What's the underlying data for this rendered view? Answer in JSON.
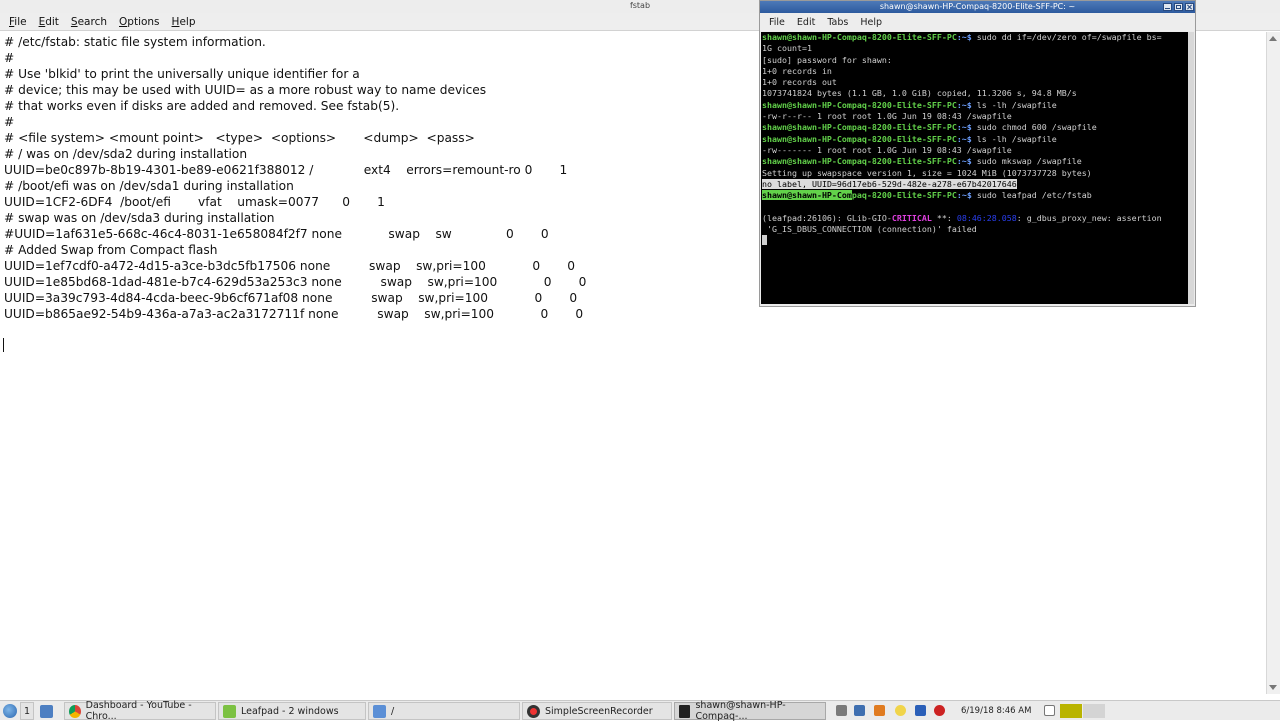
{
  "leafpad": {
    "title": "fstab",
    "menu": [
      {
        "first": "F",
        "rest": "ile"
      },
      {
        "first": "E",
        "rest": "dit"
      },
      {
        "first": "S",
        "rest": "earch"
      },
      {
        "first": "O",
        "rest": "ptions"
      },
      {
        "first": "H",
        "rest": "elp"
      }
    ],
    "lines": [
      "# /etc/fstab: static file system information.",
      "#",
      "# Use 'blkid' to print the universally unique identifier for a",
      "# device; this may be used with UUID= as a more robust way to name devices",
      "# that works even if disks are added and removed. See fstab(5).",
      "#",
      "# <file system> <mount point>   <type>  <options>       <dump>  <pass>",
      "# / was on /dev/sda2 during installation",
      "UUID=be0c897b-8b19-4301-be89-e0621f388012 /             ext4    errors=remount-ro 0       1",
      "# /boot/efi was on /dev/sda1 during installation",
      "UUID=1CF2-6DF4  /boot/efi       vfat    umask=0077      0       1",
      "# swap was on /dev/sda3 during installation",
      "#UUID=1af631e5-668c-46c4-8031-1e658084f2f7 none            swap    sw              0       0",
      "# Added Swap from Compact flash",
      "UUID=1ef7cdf0-a472-4d15-a3ce-b3dc5fb17506 none          swap    sw,pri=100            0       0",
      "UUID=1e85bd68-1dad-481e-b7c4-629d53a253c3 none          swap    sw,pri=100            0       0",
      "UUID=3a39c793-4d84-4cda-beec-9b6cf671af08 none          swap    sw,pri=100            0       0",
      "UUID=b865ae92-54b9-436a-a7a3-ac2a3172711f none          swap    sw,pri=100            0       0"
    ]
  },
  "terminal": {
    "title": "shawn@shawn-HP-Compaq-8200-Elite-SFF-PC: ~",
    "menu": [
      "File",
      "Edit",
      "Tabs",
      "Help"
    ],
    "prompt": "shawn@shawn-HP-Compaq-8200-Elite-SFF-PC",
    "path": ":~$",
    "cmd_dd_1": " sudo dd if=/dev/zero of=/swapfile bs=",
    "cmd_dd_2": "1G count=1",
    "sudo_pw": "[sudo] password for shawn:",
    "rec_in": "1+0 records in",
    "rec_out": "1+0 records out",
    "copied": "1073741824 bytes (1.1 GB, 1.0 GiB) copied, 11.3206 s, 94.8 MB/s",
    "cmd_ls_1": " ls -lh /swapfile",
    "ls_out_1": "-rw-r--r-- 1 root root 1.0G Jun 19 08:43 /swapfile",
    "cmd_chmod": " sudo chmod 600 /swapfile",
    "cmd_ls_2": " ls -lh /swapfile",
    "ls_out_2": "-rw------- 1 root root 1.0G Jun 19 08:43 /swapfile",
    "cmd_mkswap": " sudo mkswap /swapfile",
    "mkswap_out": "Setting up swapspace version 1, size = 1024 MiB (1073737728 bytes)",
    "nolabel": "no label, ",
    "uuid_selected": "UUID=96d17eb6-529d-482e-a278-e67b42017646",
    "prompt_selected": "shawn@shawn-HP-Com",
    "prompt_rest": "paq-8200-Elite-SFF-PC",
    "cmd_leafpad": " sudo leafpad /etc/fstab",
    "err_pre": "(leafpad:26106): GLib-GIO-",
    "err_crit": "CRITICAL",
    "err_mid": " **: ",
    "err_time": "08:46:28.058",
    "err_post": ": g_dbus_proxy_new: assertion",
    "err_line2": " 'G_IS_DBUS_CONNECTION (connection)' failed"
  },
  "taskbar": {
    "workspace": "1",
    "tasks": [
      {
        "label": "Dashboard - YouTube - Chro..."
      },
      {
        "label": "Leafpad - 2 windows"
      },
      {
        "label": "/"
      },
      {
        "label": "SimpleScreenRecorder"
      },
      {
        "label": "shawn@shawn-HP-Compaq-..."
      }
    ],
    "clock": "6/19/18 8:46 AM"
  },
  "colors": {
    "prompt_green": "#62d14a",
    "path_blue": "#6ea0ff",
    "critical_magenta": "#e040e0",
    "terminal_bg": "#000000"
  }
}
